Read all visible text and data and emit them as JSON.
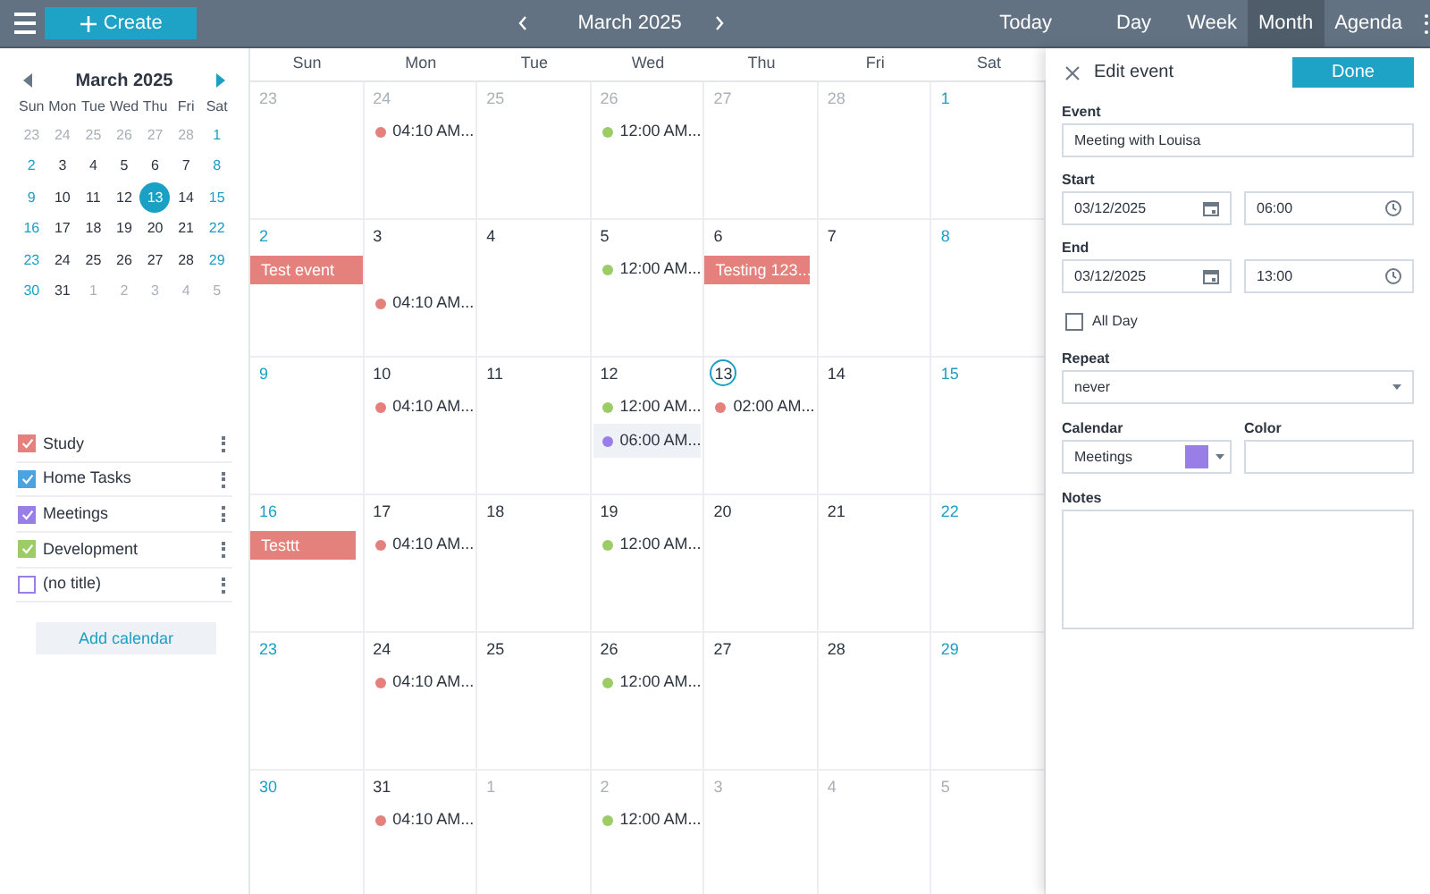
{
  "toolbar": {
    "create": "Create",
    "month_title": "March 2025",
    "today": "Today",
    "views": [
      {
        "label": "Day",
        "selected": false
      },
      {
        "label": "Week",
        "selected": false
      },
      {
        "label": "Month",
        "selected": true
      },
      {
        "label": "Agenda",
        "selected": false
      }
    ]
  },
  "mini_calendar": {
    "title": "March 2025",
    "weekdays": [
      "Sun",
      "Mon",
      "Tue",
      "Wed",
      "Thu",
      "Fri",
      "Sat"
    ],
    "weeks": [
      [
        {
          "day": "23",
          "other_month": true,
          "selected": false
        },
        {
          "day": "24",
          "other_month": true,
          "selected": false
        },
        {
          "day": "25",
          "other_month": true,
          "selected": false
        },
        {
          "day": "26",
          "other_month": true,
          "selected": false
        },
        {
          "day": "27",
          "other_month": true,
          "selected": false
        },
        {
          "day": "28",
          "other_month": true,
          "selected": false
        },
        {
          "day": "1",
          "other_month": false,
          "selected": false
        }
      ],
      [
        {
          "day": "2",
          "other_month": false,
          "selected": false
        },
        {
          "day": "3",
          "other_month": false,
          "selected": false
        },
        {
          "day": "4",
          "other_month": false,
          "selected": false
        },
        {
          "day": "5",
          "other_month": false,
          "selected": false
        },
        {
          "day": "6",
          "other_month": false,
          "selected": false
        },
        {
          "day": "7",
          "other_month": false,
          "selected": false
        },
        {
          "day": "8",
          "other_month": false,
          "selected": false
        }
      ],
      [
        {
          "day": "9",
          "other_month": false,
          "selected": false
        },
        {
          "day": "10",
          "other_month": false,
          "selected": false
        },
        {
          "day": "11",
          "other_month": false,
          "selected": false
        },
        {
          "day": "12",
          "other_month": false,
          "selected": false
        },
        {
          "day": "13",
          "other_month": false,
          "selected": true
        },
        {
          "day": "14",
          "other_month": false,
          "selected": false
        },
        {
          "day": "15",
          "other_month": false,
          "selected": false
        }
      ],
      [
        {
          "day": "16",
          "other_month": false,
          "selected": false
        },
        {
          "day": "17",
          "other_month": false,
          "selected": false
        },
        {
          "day": "18",
          "other_month": false,
          "selected": false
        },
        {
          "day": "19",
          "other_month": false,
          "selected": false
        },
        {
          "day": "20",
          "other_month": false,
          "selected": false
        },
        {
          "day": "21",
          "other_month": false,
          "selected": false
        },
        {
          "day": "22",
          "other_month": false,
          "selected": false
        }
      ],
      [
        {
          "day": "23",
          "other_month": false,
          "selected": false
        },
        {
          "day": "24",
          "other_month": false,
          "selected": false
        },
        {
          "day": "25",
          "other_month": false,
          "selected": false
        },
        {
          "day": "26",
          "other_month": false,
          "selected": false
        },
        {
          "day": "27",
          "other_month": false,
          "selected": false
        },
        {
          "day": "28",
          "other_month": false,
          "selected": false
        },
        {
          "day": "29",
          "other_month": false,
          "selected": false
        }
      ],
      [
        {
          "day": "30",
          "other_month": false,
          "selected": false
        },
        {
          "day": "31",
          "other_month": false,
          "selected": false
        },
        {
          "day": "1",
          "other_month": true,
          "selected": false
        },
        {
          "day": "2",
          "other_month": true,
          "selected": false
        },
        {
          "day": "3",
          "other_month": true,
          "selected": false
        },
        {
          "day": "4",
          "other_month": true,
          "selected": false
        },
        {
          "day": "5",
          "other_month": true,
          "selected": false
        }
      ]
    ]
  },
  "calendars": [
    {
      "name": "Study",
      "color": "#e5807c",
      "checked": true
    },
    {
      "name": "Home Tasks",
      "color": "#4ba3df",
      "checked": true
    },
    {
      "name": "Meetings",
      "color": "#9a7ee8",
      "checked": true
    },
    {
      "name": "Development",
      "color": "#9ccc65",
      "checked": true
    },
    {
      "name": "(no title)",
      "color": "#9a7ee8",
      "checked": false
    }
  ],
  "add_calendar": "Add calendar",
  "month_grid": {
    "weekdays": [
      "Sun",
      "Mon",
      "Tue",
      "Wed",
      "Thu",
      "Fri",
      "Sat"
    ],
    "weeks": [
      [
        {
          "day": "23",
          "other_month": true,
          "today": false
        },
        {
          "day": "24",
          "other_month": true,
          "today": false,
          "events": [
            {
              "kind": "dot",
              "time": "04:10 AM...",
              "color": "#e5807c",
              "selected": false
            }
          ]
        },
        {
          "day": "25",
          "other_month": true,
          "today": false
        },
        {
          "day": "26",
          "other_month": true,
          "today": false,
          "events": [
            {
              "kind": "dot",
              "time": "12:00 AM...",
              "color": "#9ccc65",
              "selected": false
            }
          ]
        },
        {
          "day": "27",
          "other_month": true,
          "today": false
        },
        {
          "day": "28",
          "other_month": true,
          "today": false
        },
        {
          "day": "1",
          "other_month": false,
          "today": false
        }
      ],
      [
        {
          "day": "2",
          "other_month": false,
          "today": false,
          "events": [
            {
              "kind": "bar",
              "title": "Test event",
              "continues": true
            }
          ]
        },
        {
          "day": "3",
          "other_month": false,
          "today": false,
          "events": [
            {
              "kind": "dot",
              "time": "04:10 AM...",
              "color": "#e5807c",
              "selected": false
            }
          ]
        },
        {
          "day": "4",
          "other_month": false,
          "today": false
        },
        {
          "day": "5",
          "other_month": false,
          "today": false,
          "events": [
            {
              "kind": "dot",
              "time": "12:00 AM...",
              "color": "#9ccc65",
              "selected": false
            }
          ]
        },
        {
          "day": "6",
          "other_month": false,
          "today": false,
          "events": [
            {
              "kind": "bar",
              "title": "Testing 123...",
              "continues": false
            }
          ]
        },
        {
          "day": "7",
          "other_month": false,
          "today": false
        },
        {
          "day": "8",
          "other_month": false,
          "today": false
        }
      ],
      [
        {
          "day": "9",
          "other_month": false,
          "today": false
        },
        {
          "day": "10",
          "other_month": false,
          "today": false,
          "events": [
            {
              "kind": "dot",
              "time": "04:10 AM...",
              "color": "#e5807c",
              "selected": false
            }
          ]
        },
        {
          "day": "11",
          "other_month": false,
          "today": false
        },
        {
          "day": "12",
          "other_month": false,
          "today": false,
          "events": [
            {
              "kind": "dot",
              "time": "12:00 AM...",
              "color": "#9ccc65",
              "selected": false
            },
            {
              "kind": "dot",
              "time": "06:00 AM...",
              "color": "#9a7ee8",
              "selected": true
            }
          ]
        },
        {
          "day": "13",
          "other_month": false,
          "today": true,
          "events": [
            {
              "kind": "dot",
              "time": "02:00 AM...",
              "color": "#e5807c",
              "selected": false
            }
          ]
        },
        {
          "day": "14",
          "other_month": false,
          "today": false
        },
        {
          "day": "15",
          "other_month": false,
          "today": false
        }
      ],
      [
        {
          "day": "16",
          "other_month": false,
          "today": false,
          "events": [
            {
              "kind": "bar",
              "title": "Testtt",
              "continues": false
            }
          ]
        },
        {
          "day": "17",
          "other_month": false,
          "today": false,
          "events": [
            {
              "kind": "dot",
              "time": "04:10 AM...",
              "color": "#e5807c",
              "selected": false
            }
          ]
        },
        {
          "day": "18",
          "other_month": false,
          "today": false
        },
        {
          "day": "19",
          "other_month": false,
          "today": false,
          "events": [
            {
              "kind": "dot",
              "time": "12:00 AM...",
              "color": "#9ccc65",
              "selected": false
            }
          ]
        },
        {
          "day": "20",
          "other_month": false,
          "today": false
        },
        {
          "day": "21",
          "other_month": false,
          "today": false
        },
        {
          "day": "22",
          "other_month": false,
          "today": false
        }
      ],
      [
        {
          "day": "23",
          "other_month": false,
          "today": false
        },
        {
          "day": "24",
          "other_month": false,
          "today": false,
          "events": [
            {
              "kind": "dot",
              "time": "04:10 AM...",
              "color": "#e5807c",
              "selected": false
            }
          ]
        },
        {
          "day": "25",
          "other_month": false,
          "today": false
        },
        {
          "day": "26",
          "other_month": false,
          "today": false,
          "events": [
            {
              "kind": "dot",
              "time": "12:00 AM...",
              "color": "#9ccc65",
              "selected": false
            }
          ]
        },
        {
          "day": "27",
          "other_month": false,
          "today": false
        },
        {
          "day": "28",
          "other_month": false,
          "today": false
        },
        {
          "day": "29",
          "other_month": false,
          "today": false
        }
      ],
      [
        {
          "day": "30",
          "other_month": false,
          "today": false
        },
        {
          "day": "31",
          "other_month": false,
          "today": false,
          "events": [
            {
              "kind": "dot",
              "time": "04:10 AM...",
              "color": "#e5807c",
              "selected": false
            }
          ]
        },
        {
          "day": "1",
          "other_month": true,
          "today": false
        },
        {
          "day": "2",
          "other_month": true,
          "today": false,
          "events": [
            {
              "kind": "dot",
              "time": "12:00 AM...",
              "color": "#9ccc65",
              "selected": false
            }
          ]
        },
        {
          "day": "3",
          "other_month": true,
          "today": false
        },
        {
          "day": "4",
          "other_month": true,
          "today": false
        },
        {
          "day": "5",
          "other_month": true,
          "today": false
        }
      ]
    ]
  },
  "edit_panel": {
    "title": "Edit event",
    "done": "Done",
    "event": {
      "label": "Event",
      "value": "Meeting with Louisa"
    },
    "start": {
      "label": "Start",
      "date": "03/12/2025",
      "time": "06:00"
    },
    "end": {
      "label": "End",
      "date": "03/12/2025",
      "time": "13:00"
    },
    "all_day": {
      "label": "All Day",
      "checked": false
    },
    "repeat": {
      "label": "Repeat",
      "value": "never"
    },
    "calendar": {
      "label": "Calendar",
      "value": "Meetings",
      "color": "#9a7ee8"
    },
    "color_field": {
      "label": "Color"
    },
    "notes": {
      "label": "Notes"
    }
  }
}
